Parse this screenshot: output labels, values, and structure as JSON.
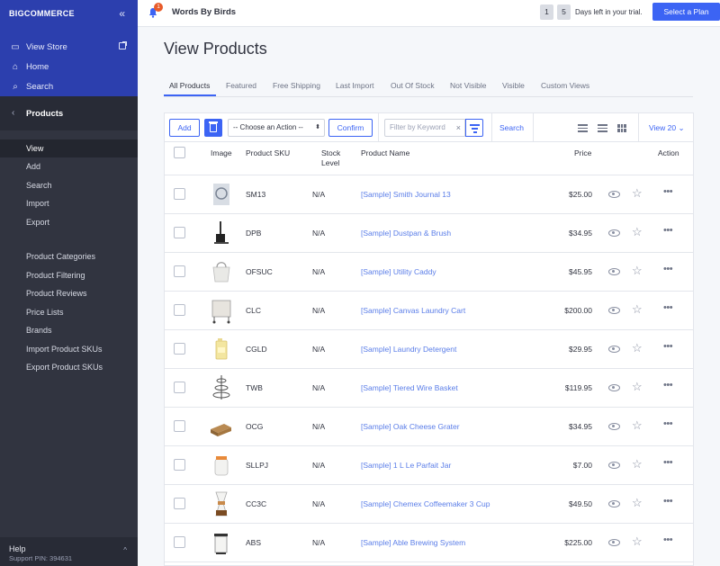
{
  "sidebar": {
    "logo": "BIGCOMMERCE",
    "top_links": [
      {
        "label": "View Store",
        "icon": "store-icon"
      },
      {
        "label": "Home",
        "icon": "home-icon"
      },
      {
        "label": "Search",
        "icon": "search-icon"
      }
    ],
    "section_title": "Products",
    "items": [
      "View",
      "Add",
      "Search",
      "Import",
      "Export"
    ],
    "items2": [
      "Product Categories",
      "Product Filtering",
      "Product Reviews",
      "Price Lists",
      "Brands",
      "Import Product SKUs",
      "Export Product SKUs"
    ],
    "help": "Help",
    "support_pin": "Support PIN: 394631"
  },
  "topbar": {
    "notification_count": "1",
    "store_name": "Words By Birds",
    "trial_days": [
      "1",
      "5"
    ],
    "trial_text": "Days left in your trial.",
    "plan_button": "Select a Plan"
  },
  "page": {
    "title": "View Products",
    "tabs": [
      "All Products",
      "Featured",
      "Free Shipping",
      "Last Import",
      "Out Of Stock",
      "Not Visible",
      "Visible",
      "Custom Views"
    ]
  },
  "toolbar": {
    "add": "Add",
    "action_select": "-- Choose an Action --",
    "confirm": "Confirm",
    "filter_placeholder": "Filter by Keyword",
    "search": "Search",
    "view_count": "View 20"
  },
  "table": {
    "headers": {
      "image": "Image",
      "sku": "Product SKU",
      "stock": "Stock Level",
      "name": "Product Name",
      "price": "Price",
      "action": "Action"
    },
    "rows": [
      {
        "sku": "SM13",
        "stock": "N/A",
        "name": "[Sample] Smith Journal 13",
        "price": "$25.00"
      },
      {
        "sku": "DPB",
        "stock": "N/A",
        "name": "[Sample] Dustpan & Brush",
        "price": "$34.95"
      },
      {
        "sku": "OFSUC",
        "stock": "N/A",
        "name": "[Sample] Utility Caddy",
        "price": "$45.95"
      },
      {
        "sku": "CLC",
        "stock": "N/A",
        "name": "[Sample] Canvas Laundry Cart",
        "price": "$200.00"
      },
      {
        "sku": "CGLD",
        "stock": "N/A",
        "name": "[Sample] Laundry Detergent",
        "price": "$29.95"
      },
      {
        "sku": "TWB",
        "stock": "N/A",
        "name": "[Sample] Tiered Wire Basket",
        "price": "$119.95"
      },
      {
        "sku": "OCG",
        "stock": "N/A",
        "name": "[Sample] Oak Cheese Grater",
        "price": "$34.95"
      },
      {
        "sku": "SLLPJ",
        "stock": "N/A",
        "name": "[Sample] 1 L Le Parfait Jar",
        "price": "$7.00"
      },
      {
        "sku": "CC3C",
        "stock": "N/A",
        "name": "[Sample] Chemex Coffeemaker 3 Cup",
        "price": "$49.50"
      },
      {
        "sku": "ABS",
        "stock": "N/A",
        "name": "[Sample] Able Brewing System",
        "price": "$225.00"
      }
    ]
  }
}
